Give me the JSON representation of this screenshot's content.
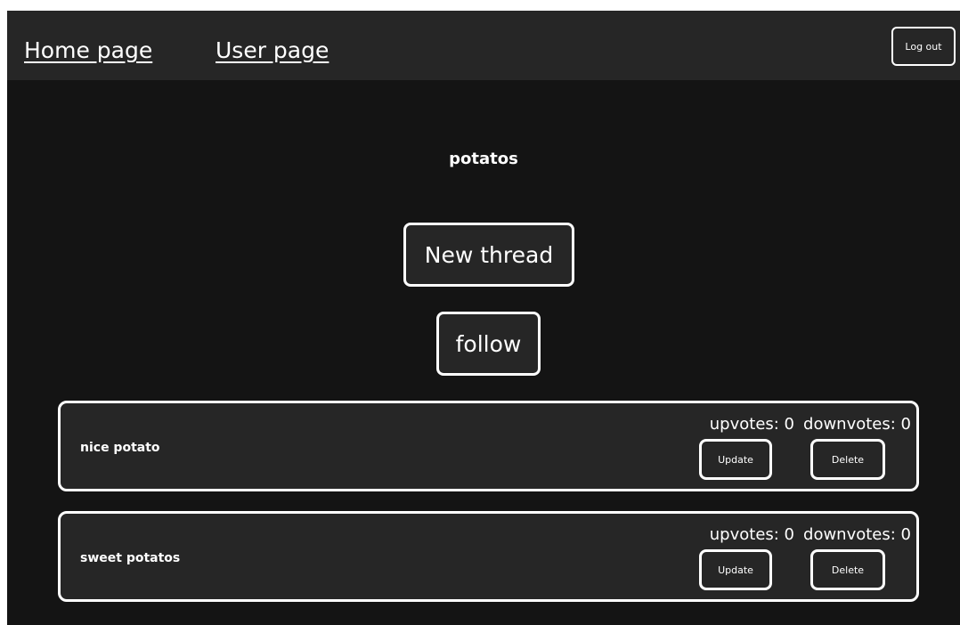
{
  "nav": {
    "home_label": "Home page",
    "user_label": "User page",
    "logout_label": "Log out"
  },
  "forum": {
    "title": "potatos",
    "new_thread_label": "New thread",
    "follow_label": "follow"
  },
  "threads": [
    {
      "title": "nice potato",
      "upvotes_text": "upvotes: 0",
      "downvotes_text": "downvotes: 0",
      "update_label": "Update",
      "delete_label": "Delete"
    },
    {
      "title": "sweet potatos",
      "upvotes_text": "upvotes: 0",
      "downvotes_text": "downvotes: 0",
      "update_label": "Update",
      "delete_label": "Delete"
    }
  ],
  "colors": {
    "page_background": "#141414",
    "navbar_background": "#262626",
    "card_background": "#262626",
    "border": "#ffffff",
    "text": "#ffffff"
  }
}
